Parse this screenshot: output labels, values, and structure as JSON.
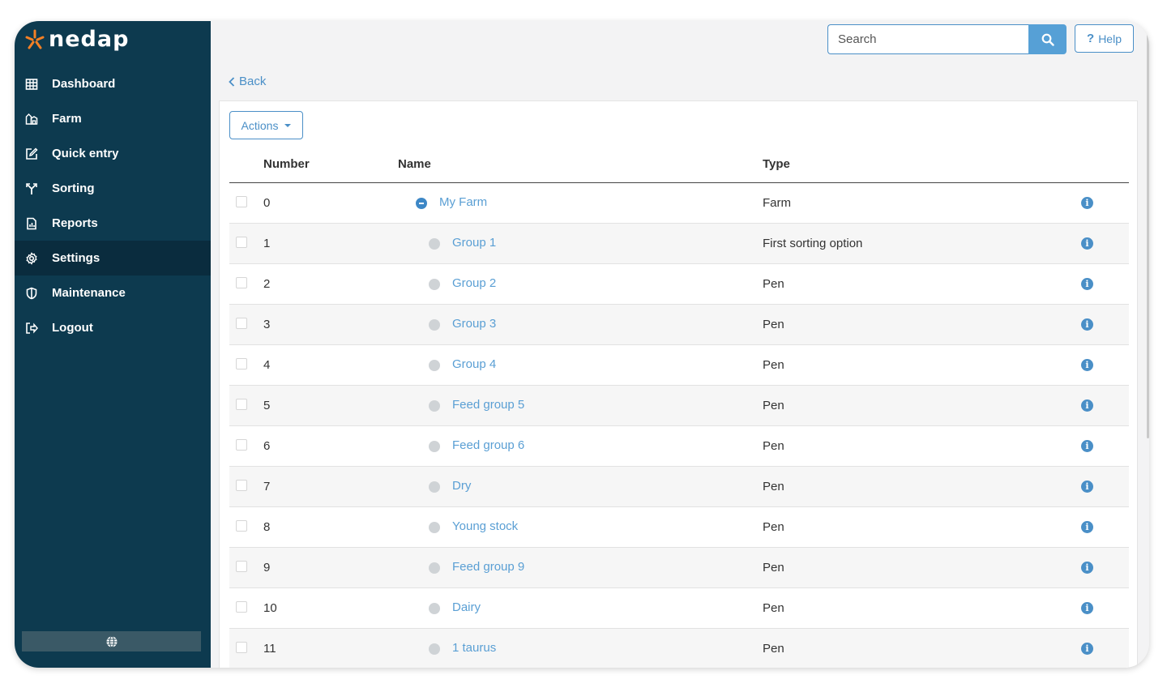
{
  "brand": {
    "name": "nedap",
    "accent": "#f58025",
    "sidebar_bg": "#0d3a4f",
    "link_color": "#4a8fc7"
  },
  "sidebar": {
    "items": [
      {
        "label": "Dashboard",
        "icon": "grid-icon"
      },
      {
        "label": "Farm",
        "icon": "barn-icon"
      },
      {
        "label": "Quick entry",
        "icon": "edit-icon"
      },
      {
        "label": "Sorting",
        "icon": "split-arrows-icon"
      },
      {
        "label": "Reports",
        "icon": "report-icon"
      },
      {
        "label": "Settings",
        "icon": "gear-icon",
        "active": true
      },
      {
        "label": "Maintenance",
        "icon": "shield-icon"
      },
      {
        "label": "Logout",
        "icon": "logout-icon"
      }
    ],
    "language_icon": "globe-icon"
  },
  "header": {
    "search_placeholder": "Search",
    "help_label": "Help",
    "help_symbol": "?"
  },
  "back_label": "Back",
  "actions_label": "Actions",
  "table": {
    "columns": [
      "Number",
      "Name",
      "Type"
    ],
    "rows": [
      {
        "number": "0",
        "name": "My Farm",
        "type": "Farm"
      },
      {
        "number": "1",
        "name": "Group 1",
        "type": "First sorting option"
      },
      {
        "number": "2",
        "name": "Group 2",
        "type": "Pen"
      },
      {
        "number": "3",
        "name": "Group 3",
        "type": "Pen"
      },
      {
        "number": "4",
        "name": "Group 4",
        "type": "Pen"
      },
      {
        "number": "5",
        "name": "Feed group 5",
        "type": "Pen"
      },
      {
        "number": "6",
        "name": "Feed group 6",
        "type": "Pen"
      },
      {
        "number": "7",
        "name": "Dry",
        "type": "Pen"
      },
      {
        "number": "8",
        "name": "Young stock",
        "type": "Pen"
      },
      {
        "number": "9",
        "name": "Feed group 9",
        "type": "Pen"
      },
      {
        "number": "10",
        "name": "Dairy",
        "type": "Pen"
      },
      {
        "number": "11",
        "name": "1 taurus",
        "type": "Pen"
      }
    ]
  }
}
